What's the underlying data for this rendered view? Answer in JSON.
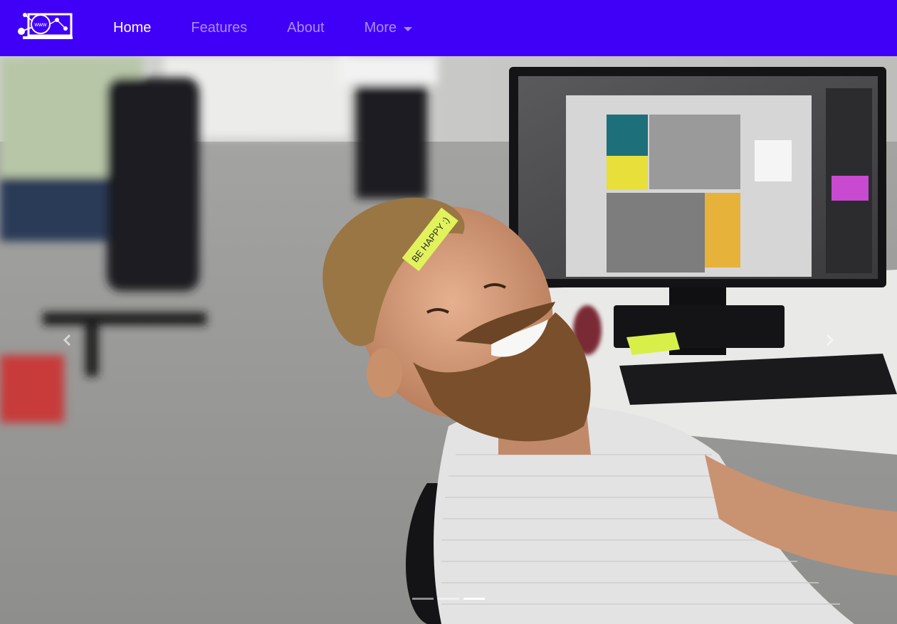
{
  "brand": {
    "logo_icon": "network-laptop-logo-icon",
    "logo_text": "www"
  },
  "nav": {
    "items": [
      {
        "label": "Home",
        "active": true
      },
      {
        "label": "Features",
        "active": false
      },
      {
        "label": "About",
        "active": false
      },
      {
        "label": "More",
        "active": false,
        "dropdown": true
      }
    ]
  },
  "carousel": {
    "slide_image": "office-man-smiling-photo",
    "prev_icon": "chevron-left-icon",
    "next_icon": "chevron-right-icon",
    "slide_count": 3,
    "active_slide": 3
  },
  "colors": {
    "navbar_bg": "#4000f8",
    "nav_active": "#ffffff",
    "nav_inactive": "rgba(255,255,255,0.55)"
  }
}
